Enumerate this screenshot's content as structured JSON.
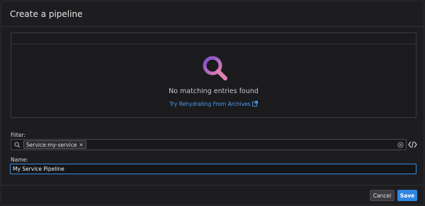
{
  "dialog": {
    "title": "Create a pipeline"
  },
  "results": {
    "empty_message": "No matching entries found",
    "link_text": "Try Rehydrating From Archives",
    "icon": "search-icon"
  },
  "filter": {
    "label": "Filter:",
    "token": "Service:my-service",
    "token_remove": "✕"
  },
  "name": {
    "label": "Name:",
    "value": "My Service Pipeline"
  },
  "footer": {
    "cancel_label": "Cancel",
    "save_label": "Save"
  },
  "colors": {
    "accent": "#2f86e0",
    "link": "#4d9ff0",
    "icon_gradient_start": "#7b4fc9",
    "icon_gradient_end": "#e07fb4"
  }
}
